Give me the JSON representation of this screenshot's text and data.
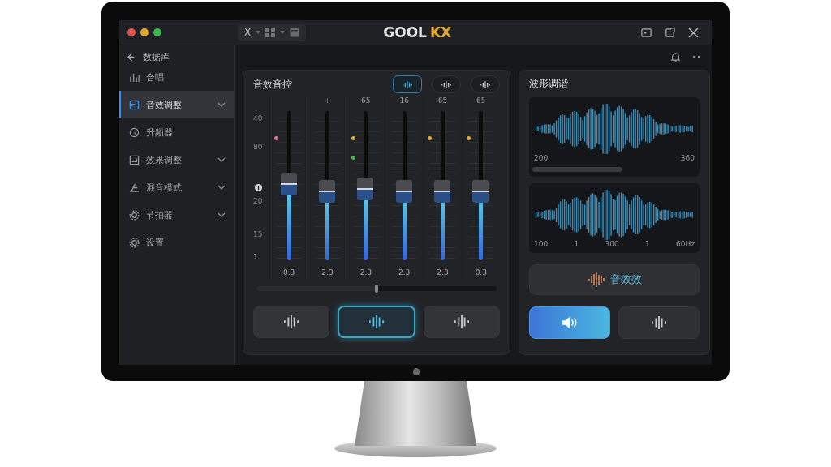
{
  "window": {
    "toolbar_label": "X",
    "logo_left": "GOOL",
    "logo_right": "KX"
  },
  "sidebar": {
    "back_label": "数据库",
    "items": [
      {
        "label": "合唱",
        "selected": false,
        "has_submenu": false
      },
      {
        "label": "音效调整",
        "selected": true,
        "has_submenu": true
      },
      {
        "label": "升频器",
        "selected": false,
        "has_submenu": false
      },
      {
        "label": "效果调整",
        "selected": false,
        "has_submenu": true
      },
      {
        "label": "混音模式",
        "selected": false,
        "has_submenu": true
      },
      {
        "label": "节拍器",
        "selected": false,
        "has_submenu": true
      },
      {
        "label": "设置",
        "selected": false,
        "has_submenu": false
      }
    ]
  },
  "mixer": {
    "title": "音效音控",
    "modes": [
      {
        "selected": true
      },
      {
        "selected": false
      },
      {
        "selected": false
      }
    ],
    "scale": [
      "40",
      "80",
      "20",
      "15",
      "1"
    ],
    "channels": [
      {
        "level": 0.51,
        "value": "0.3",
        "dots": [
          {
            "color": "#e07a8a"
          }
        ]
      },
      {
        "header": "+",
        "level": 0.46,
        "value": "2.3"
      },
      {
        "header": "65",
        "level": 0.48,
        "value": "2.8",
        "dots": [
          {
            "color": "#e0b030"
          },
          {
            "color": "#3cc04a"
          }
        ]
      },
      {
        "header": "16",
        "level": 0.46,
        "value": "2.3"
      },
      {
        "header": "65",
        "level": 0.46,
        "value": "2.3",
        "dots": [
          {
            "color": "#e0b030"
          }
        ]
      },
      {
        "header": "65",
        "level": 0.46,
        "value": "0.3",
        "dots": [
          {
            "color": "#e0b030"
          }
        ]
      }
    ],
    "balance": {
      "level": 0.5
    },
    "presets": [
      {
        "selected": false
      },
      {
        "selected": true
      },
      {
        "selected": false
      }
    ]
  },
  "analyzer": {
    "title": "波形调谐",
    "waves": [
      {
        "labels": [
          "200",
          "360"
        ]
      },
      {
        "labels": [
          "100",
          "1",
          "300",
          "1",
          "60Hz"
        ]
      }
    ],
    "effect_button": "音效效",
    "buttons": [
      {
        "selected": true
      },
      {
        "selected": false
      }
    ]
  }
}
